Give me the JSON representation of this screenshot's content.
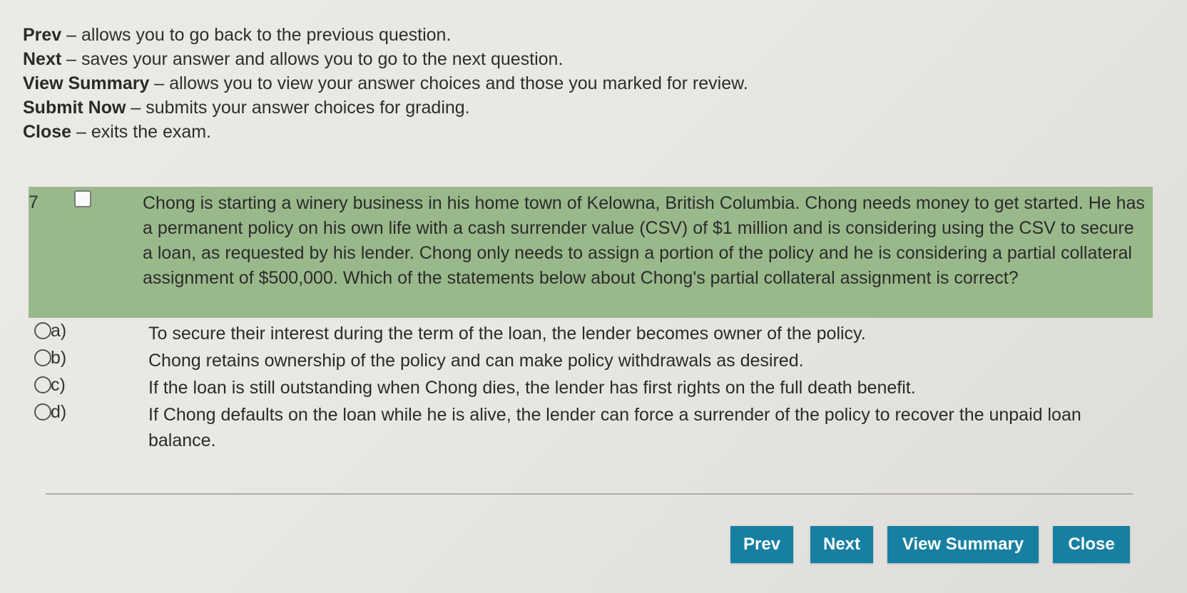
{
  "instructions": [
    {
      "term": "Prev",
      "desc": "allows you to go back to the previous question."
    },
    {
      "term": "Next",
      "desc": "saves your answer and allows you to go to the next question."
    },
    {
      "term": "View Summary",
      "desc": "allows you to view your answer choices and those you marked for review."
    },
    {
      "term": "Submit Now",
      "desc": "submits your answer choices for grading."
    },
    {
      "term": "Close",
      "desc": "exits the exam."
    }
  ],
  "separator": "–",
  "question": {
    "number": "7",
    "marked_for_review": false,
    "text": "Chong is starting a winery business in his home town of Kelowna, British Columbia. Chong needs money to get started. He has a permanent policy on his own life with a cash surrender value (CSV) of $1 million and is considering using the CSV to secure a loan, as requested by his lender. Chong only needs to assign a portion of the policy and he is considering a partial collateral assignment of $500,000. Which of the statements below about Chong's partial collateral assignment is correct?",
    "options": [
      {
        "letter": "a)",
        "text": "To secure their interest during the term of the loan, the lender becomes owner of the policy."
      },
      {
        "letter": "b)",
        "text": "Chong retains ownership of the policy and can make policy withdrawals as desired."
      },
      {
        "letter": "c)",
        "text": "If the loan is still outstanding when Chong dies, the lender has first rights on the full death benefit."
      },
      {
        "letter": "d)",
        "text": "If Chong defaults on the loan while he is alive, the lender can force a surrender of the policy to recover the unpaid loan balance."
      }
    ]
  },
  "buttons": {
    "prev": "Prev",
    "next": "Next",
    "view_summary": "View Summary",
    "close": "Close"
  },
  "colors": {
    "question_highlight": "#9ab98b",
    "button_bg": "#1780a2",
    "button_text": "#ffffff"
  }
}
